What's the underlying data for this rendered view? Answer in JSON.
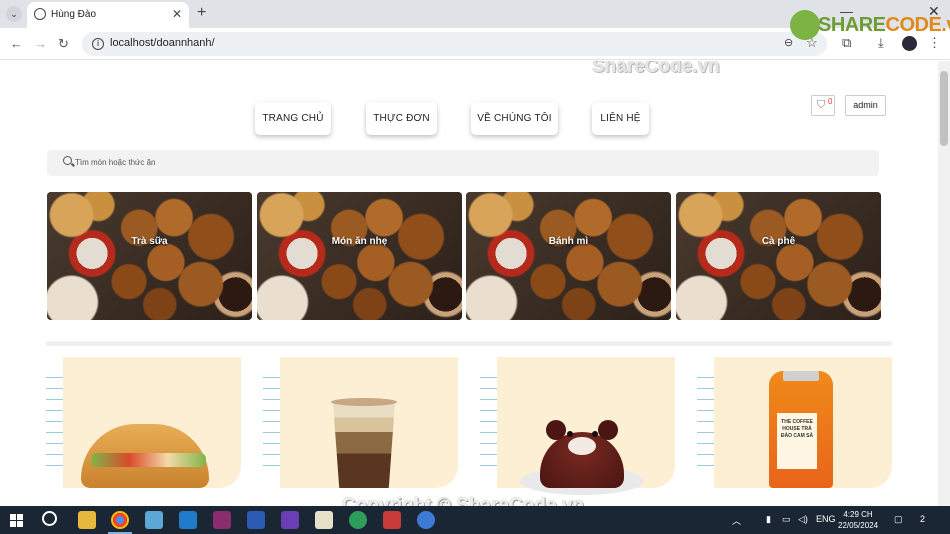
{
  "browser": {
    "tab_title": "Hùng Đào",
    "tab_close": "✕",
    "new_tab": "+",
    "url": "localhost/doannhanh/",
    "win_min": "—",
    "win_close": "✕"
  },
  "watermark": {
    "logo_share": "SHARE",
    "logo_code": "CODE.vn",
    "top": "ShareCode.vn",
    "bottom": "Copyright © ShareCode.vn"
  },
  "header": {
    "nav": [
      "TRANG CHỦ",
      "THỰC ĐƠN",
      "VỀ CHÚNG TÔI",
      "LIÊN HỆ"
    ],
    "cart_count": "0",
    "admin_label": "admin"
  },
  "search": {
    "placeholder": "Tìm món hoặc thức ăn"
  },
  "categories": [
    "Trà sữa",
    "Món ăn nhẹ",
    "Bánh mì",
    "Cà phê"
  ],
  "products": [
    "banh-mi",
    "ca-phe",
    "banh-ngot-gau",
    "tra-dao-cam-sa"
  ],
  "product_bottle_text": "THE COFFEE HOUSE TRÀ ĐÀO CAM SẢ",
  "taskbar": {
    "lang": "ENG",
    "time": "4:29 CH",
    "date": "22/05/2024",
    "notif_count": "2"
  }
}
